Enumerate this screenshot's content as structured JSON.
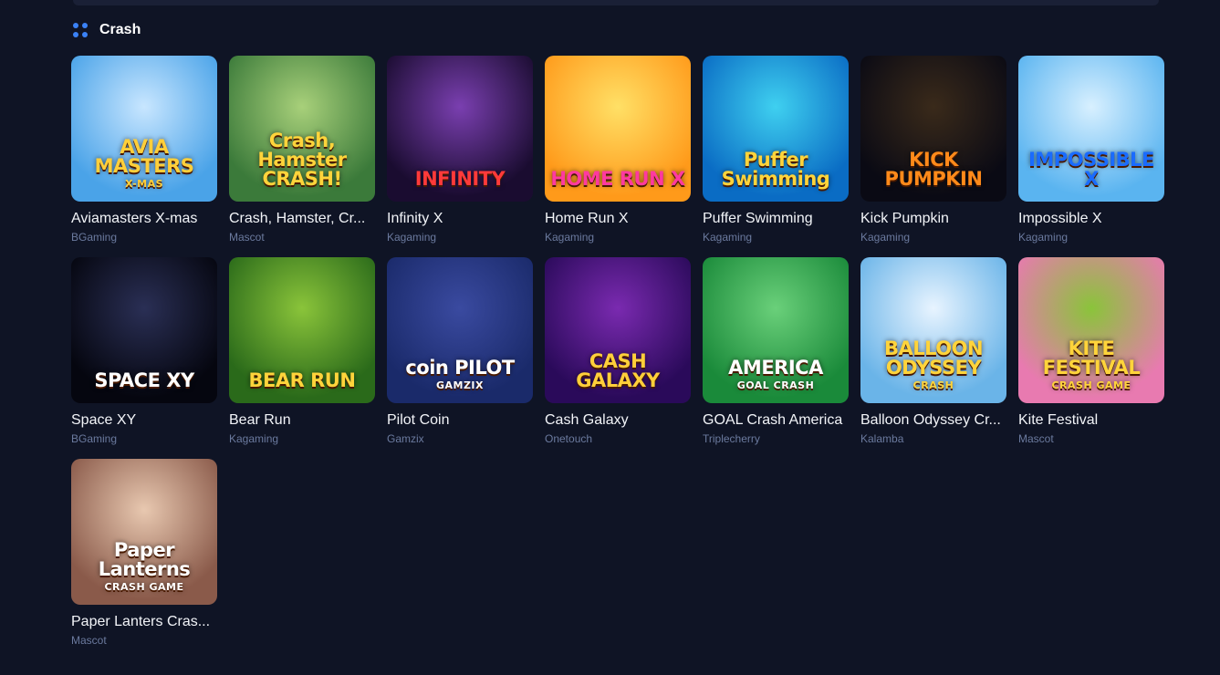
{
  "section": {
    "title": "Crash",
    "icon": "grid-dots-icon"
  },
  "games": [
    {
      "name": "Aviamasters X-mas",
      "provider": "BGaming",
      "logo": "AVIA MASTERS",
      "logo_sub": "X-MAS",
      "colors": [
        "#4aa3e8",
        "#c8e6ff"
      ],
      "logo_color": "#ffcf3a"
    },
    {
      "name": "Crash, Hamster, Cr...",
      "provider": "Mascot",
      "logo": "Crash, Hamster CRASH!",
      "logo_sub": "",
      "colors": [
        "#3b7a3a",
        "#a8d07a"
      ],
      "logo_color": "#ffd43b"
    },
    {
      "name": "Infinity X",
      "provider": "Kagaming",
      "logo": "INFINITY",
      "logo_sub": "",
      "colors": [
        "#1a0c30",
        "#7a3fb0"
      ],
      "logo_color": "#ff3a3a"
    },
    {
      "name": "Home Run X",
      "provider": "Kagaming",
      "logo": "HOME RUN X",
      "logo_sub": "",
      "colors": [
        "#ff9a1a",
        "#ffe066"
      ],
      "logo_color": "#ff3aa0"
    },
    {
      "name": "Puffer Swimming",
      "provider": "Kagaming",
      "logo": "Puffer Swimming",
      "logo_sub": "",
      "colors": [
        "#0a6cc4",
        "#3fd0f0"
      ],
      "logo_color": "#ffd43b"
    },
    {
      "name": "Kick Pumpkin",
      "provider": "Kagaming",
      "logo": "KICK PUMPKIN",
      "logo_sub": "",
      "colors": [
        "#0a0a14",
        "#3a2a1a"
      ],
      "logo_color": "#ff8a1a"
    },
    {
      "name": "Impossible X",
      "provider": "Kagaming",
      "logo": "IMPOSSIBLE X",
      "logo_sub": "",
      "colors": [
        "#5ab4f0",
        "#d8f0ff"
      ],
      "logo_color": "#1a6cff"
    },
    {
      "name": "Space XY",
      "provider": "BGaming",
      "logo": "SPACE XY",
      "logo_sub": "",
      "colors": [
        "#05060f",
        "#2a2f55"
      ],
      "logo_color": "#ffffff"
    },
    {
      "name": "Bear Run",
      "provider": "Kagaming",
      "logo": "BEAR RUN",
      "logo_sub": "",
      "colors": [
        "#2a6a1a",
        "#8ac43a"
      ],
      "logo_color": "#ffd43b"
    },
    {
      "name": "Pilot Coin",
      "provider": "Gamzix",
      "logo": "coin PILOT",
      "logo_sub": "GAMZIX",
      "colors": [
        "#1a2a6a",
        "#3a4aa0"
      ],
      "logo_color": "#ffffff"
    },
    {
      "name": "Cash Galaxy",
      "provider": "Onetouch",
      "logo": "CASH GALAXY",
      "logo_sub": "",
      "colors": [
        "#2a0a5a",
        "#7a2ab0"
      ],
      "logo_color": "#ffcf3a"
    },
    {
      "name": "GOAL Crash America",
      "provider": "Triplecherry",
      "logo": "AMERICA",
      "logo_sub": "GOAL CRASH",
      "colors": [
        "#1a8a3a",
        "#6ad07a"
      ],
      "logo_color": "#ffffff"
    },
    {
      "name": "Balloon Odyssey Cr...",
      "provider": "Kalamba",
      "logo": "BALLOON ODYSSEY",
      "logo_sub": "CRASH",
      "colors": [
        "#6ab4e8",
        "#e8f4ff"
      ],
      "logo_color": "#ffd43b"
    },
    {
      "name": "Kite Festival",
      "provider": "Mascot",
      "logo": "KITE FESTIVAL",
      "logo_sub": "CRASH GAME",
      "colors": [
        "#e87ab0",
        "#8ac43a"
      ],
      "logo_color": "#ffd43b"
    },
    {
      "name": "Paper Lanters Cras...",
      "provider": "Mascot",
      "logo": "Paper Lanterns",
      "logo_sub": "CRASH GAME",
      "colors": [
        "#8a5a4a",
        "#e8c8b0"
      ],
      "logo_color": "#ffffff"
    }
  ]
}
